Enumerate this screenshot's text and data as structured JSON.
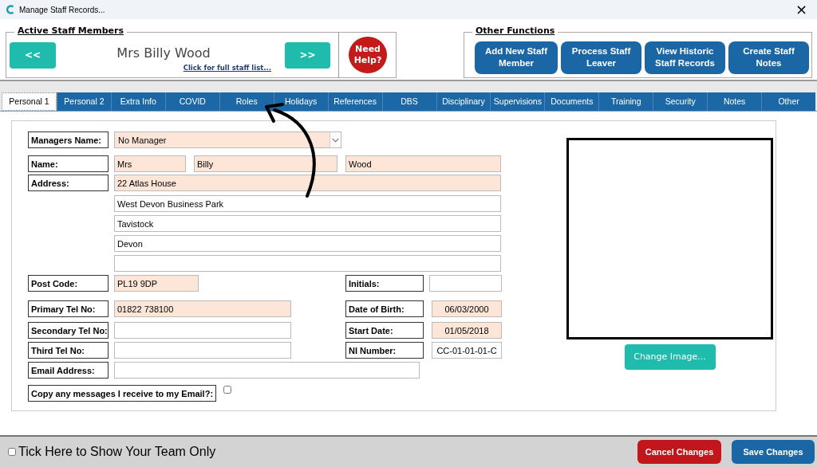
{
  "window": {
    "title": "Manage Staff Records...",
    "close": "×"
  },
  "active_staff": {
    "legend": "Active Staff Members",
    "prev": "<<",
    "name": "Mrs Billy Wood",
    "link": "Click for full staff list...",
    "next": ">>",
    "help": "Need Help?"
  },
  "other_functions": {
    "legend": "Other Functions",
    "buttons": [
      "Add New Staff Member",
      "Process Staff Leaver",
      "View Historic Staff Records",
      "Create Staff Notes"
    ]
  },
  "tabs": [
    {
      "label": "Personal 1",
      "selected": true
    },
    {
      "label": "Personal 2",
      "selected": false
    },
    {
      "label": "Extra Info",
      "selected": false
    },
    {
      "label": "COVID",
      "selected": false
    },
    {
      "label": "Roles",
      "selected": false
    },
    {
      "label": "Holidays",
      "selected": false
    },
    {
      "label": "References",
      "selected": false
    },
    {
      "label": "DBS",
      "selected": false
    },
    {
      "label": "Disciplinary",
      "selected": false
    },
    {
      "label": "Supervisions",
      "selected": false
    },
    {
      "label": "Documents",
      "selected": false
    },
    {
      "label": "Training",
      "selected": false
    },
    {
      "label": "Security",
      "selected": false
    },
    {
      "label": "Notes",
      "selected": false
    },
    {
      "label": "Other",
      "selected": false
    }
  ],
  "manager": {
    "label": "Managers Name:",
    "value": "No Manager",
    "required": true
  },
  "name": {
    "label": "Name:",
    "parts": [
      {
        "value": "Mrs",
        "required": true
      },
      {
        "value": "Billy",
        "required": true
      },
      {
        "value": "Wood",
        "required": true
      }
    ]
  },
  "address": {
    "label": "Address:",
    "lines": [
      {
        "value": "22 Atlas House",
        "required": true
      },
      {
        "value": "West Devon Business Park",
        "required": false
      },
      {
        "value": "Tavistock",
        "required": false
      },
      {
        "value": "Devon",
        "required": false
      },
      {
        "required": false
      }
    ]
  },
  "rows": [
    {
      "left": {
        "label": "Post Code:",
        "value": "PL19 9DP",
        "required": true
      },
      "right": {
        "label": "Initials:",
        "required": false
      }
    },
    {
      "left": {
        "label": "Primary Tel No:",
        "value": "01822 738100",
        "required": true
      },
      "right": {
        "label": "Date of Birth:",
        "value": "06/03/2000",
        "required": true
      }
    },
    {
      "left": {
        "label": "Secondary Tel No:",
        "required": false
      },
      "right": {
        "label": "Start Date:",
        "value": "01/05/2018",
        "required": true
      }
    },
    {
      "left": {
        "label": "Third Tel No:",
        "required": false
      },
      "right": {
        "label": "NI Number:",
        "value": "CC-01-01-01-C",
        "required": false
      }
    },
    {
      "left": {
        "label": "Email Address:",
        "required": false
      }
    }
  ],
  "copy_email": {
    "label": "Copy any messages I receive to my Email?:",
    "checked": false
  },
  "change_image": "Change Image...",
  "footer": {
    "team_only": {
      "label": "Tick Here to Show Your Team Only",
      "checked": false
    },
    "cancel": "Cancel Changes",
    "save": "Save Changes"
  }
}
